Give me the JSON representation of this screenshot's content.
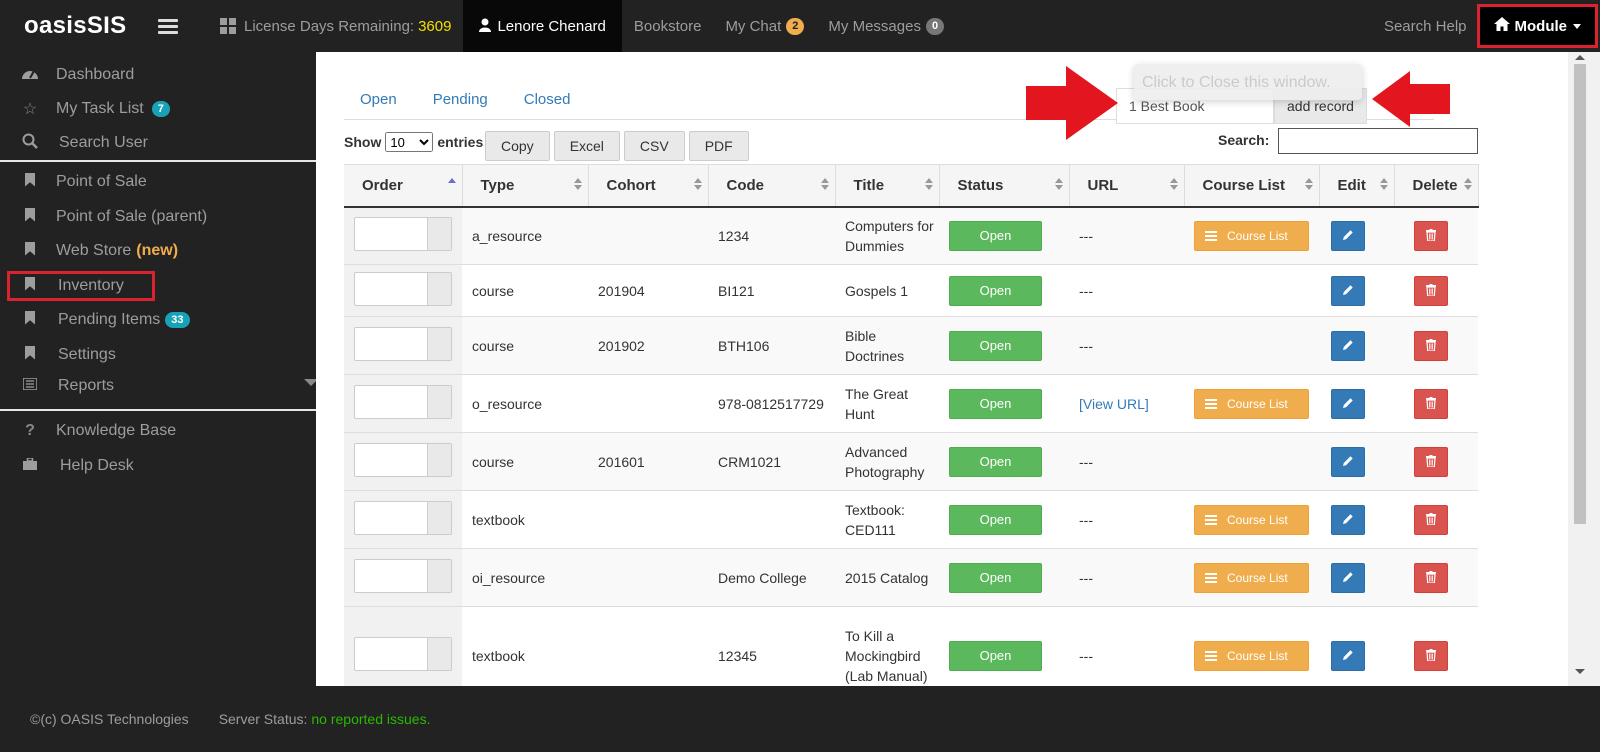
{
  "topnav": {
    "brand": "oasisSIS",
    "license_label": "License Days Remaining:",
    "license_days": "3609",
    "user": "Lenore Chenard",
    "bookstore": "Bookstore",
    "my_chat": "My Chat",
    "my_chat_count": "2",
    "my_messages": "My Messages",
    "my_messages_count": "0",
    "search_help": "Search Help",
    "module": "Module"
  },
  "sidebar": {
    "dashboard": "Dashboard",
    "task_list": "My Task List",
    "task_count": "7",
    "search_user": "Search User",
    "pos": "Point of Sale",
    "pos_parent": "Point of Sale (parent)",
    "web_store": "Web Store",
    "web_store_new": "(new)",
    "inventory": "Inventory",
    "pending": "Pending Items",
    "pending_count": "33",
    "settings": "Settings",
    "reports": "Reports",
    "kb": "Knowledge Base",
    "help_desk": "Help Desk"
  },
  "tabs": [
    "Open",
    "Pending",
    "Closed"
  ],
  "tooltip": "Click to Close this window.",
  "add_record": {
    "value": "1 Best Book",
    "button": "add record"
  },
  "table_controls": {
    "show": "Show",
    "entries": "entries",
    "page_size": "10",
    "buttons": [
      "Copy",
      "Excel",
      "CSV",
      "PDF"
    ],
    "search_label": "Search:"
  },
  "columns": [
    "Order",
    "Type",
    "Cohort",
    "Code",
    "Title",
    "Status",
    "URL",
    "Course List",
    "Edit",
    "Delete"
  ],
  "rows": [
    {
      "type": "a_resource",
      "cohort": "",
      "code": "1234",
      "title": "Computers for Dummies",
      "status": "Open",
      "url": "---",
      "course_list": "Course List"
    },
    {
      "type": "course",
      "cohort": "201904",
      "code": "BI121",
      "title": "Gospels 1",
      "status": "Open",
      "url": "---",
      "course_list": ""
    },
    {
      "type": "course",
      "cohort": "201902",
      "code": "BTH106",
      "title": "Bible Doctrines",
      "status": "Open",
      "url": "---",
      "course_list": ""
    },
    {
      "type": "o_resource",
      "cohort": "",
      "code": "978-0812517729",
      "title": "The Great Hunt",
      "status": "Open",
      "url": "[View URL]",
      "course_list": "Course List"
    },
    {
      "type": "course",
      "cohort": "201601",
      "code": "CRM1021",
      "title": "Advanced Photography",
      "status": "Open",
      "url": "---",
      "course_list": ""
    },
    {
      "type": "textbook",
      "cohort": "",
      "code": "",
      "title": "Textbook: CED111",
      "status": "Open",
      "url": "---",
      "course_list": "Course List"
    },
    {
      "type": "oi_resource",
      "cohort": "",
      "code": "Demo College",
      "title": "2015 Catalog",
      "status": "Open",
      "url": "---",
      "course_list": "Course List"
    },
    {
      "type": "textbook",
      "cohort": "",
      "code": "12345",
      "title": "To Kill a Mockingbird (Lab Manual)",
      "status": "Open",
      "url": "---",
      "course_list": "Course List"
    }
  ],
  "footer": {
    "copyright": "©(c) OASIS Technologies",
    "server_status": "Server Status:",
    "status_value": "no reported issues."
  },
  "colors": {
    "accent_red": "#d9232e",
    "open_green": "#5cb85c",
    "course_orange": "#f0ad4e",
    "edit_blue": "#337ab7",
    "delete_red": "#d9534f"
  }
}
